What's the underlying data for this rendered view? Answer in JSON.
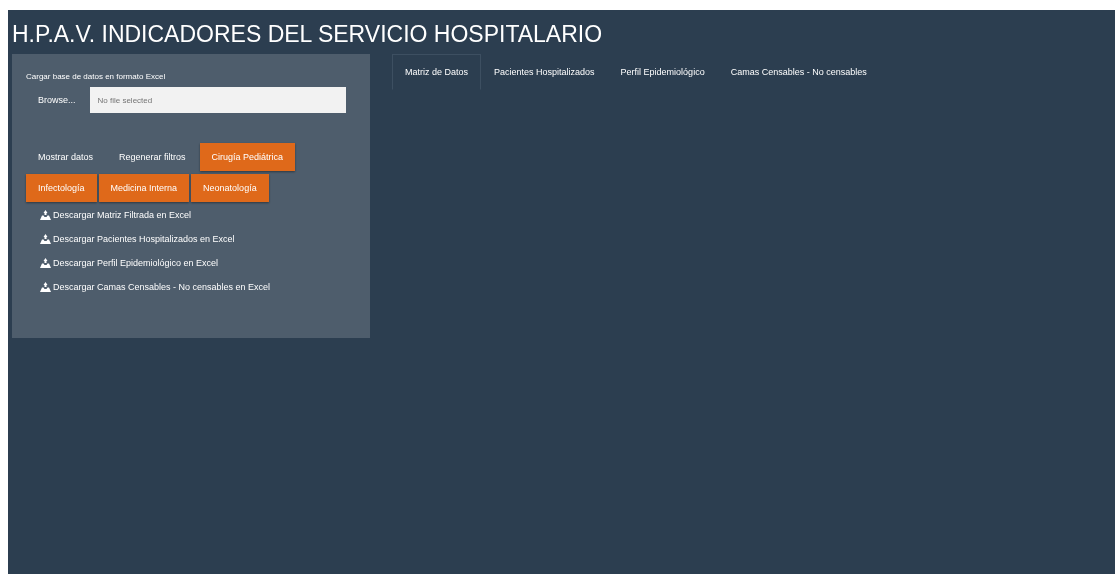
{
  "title": "H.P.A.V. INDICADORES DEL SERVICIO HOSPITALARIO",
  "upload": {
    "label": "Cargar base de datos en formato Excel",
    "button": "Browse...",
    "placeholder": "No file selected"
  },
  "buttons": [
    {
      "label": "Mostrar datos",
      "kind": "plain"
    },
    {
      "label": "Regenerar filtros",
      "kind": "plain"
    },
    {
      "label": "Cirugía Pediátrica",
      "kind": "filter"
    },
    {
      "label": "Infectología",
      "kind": "filter"
    },
    {
      "label": "Medicina Interna",
      "kind": "filter"
    },
    {
      "label": "Neonatología",
      "kind": "filter"
    }
  ],
  "downloads": [
    "Descargar Matriz Filtrada en Excel",
    "Descargar Pacientes Hospitalizados en Excel",
    "Descargar Perfil Epidemiológico en Excel",
    "Descargar Camas Censables - No censables en Excel"
  ],
  "tabs": [
    {
      "label": "Matriz de Datos",
      "selected": true
    },
    {
      "label": "Pacientes Hospitalizados",
      "selected": false
    },
    {
      "label": "Perfil Epidemiológico",
      "selected": false
    },
    {
      "label": "Camas Censables - No censables",
      "selected": false
    }
  ]
}
